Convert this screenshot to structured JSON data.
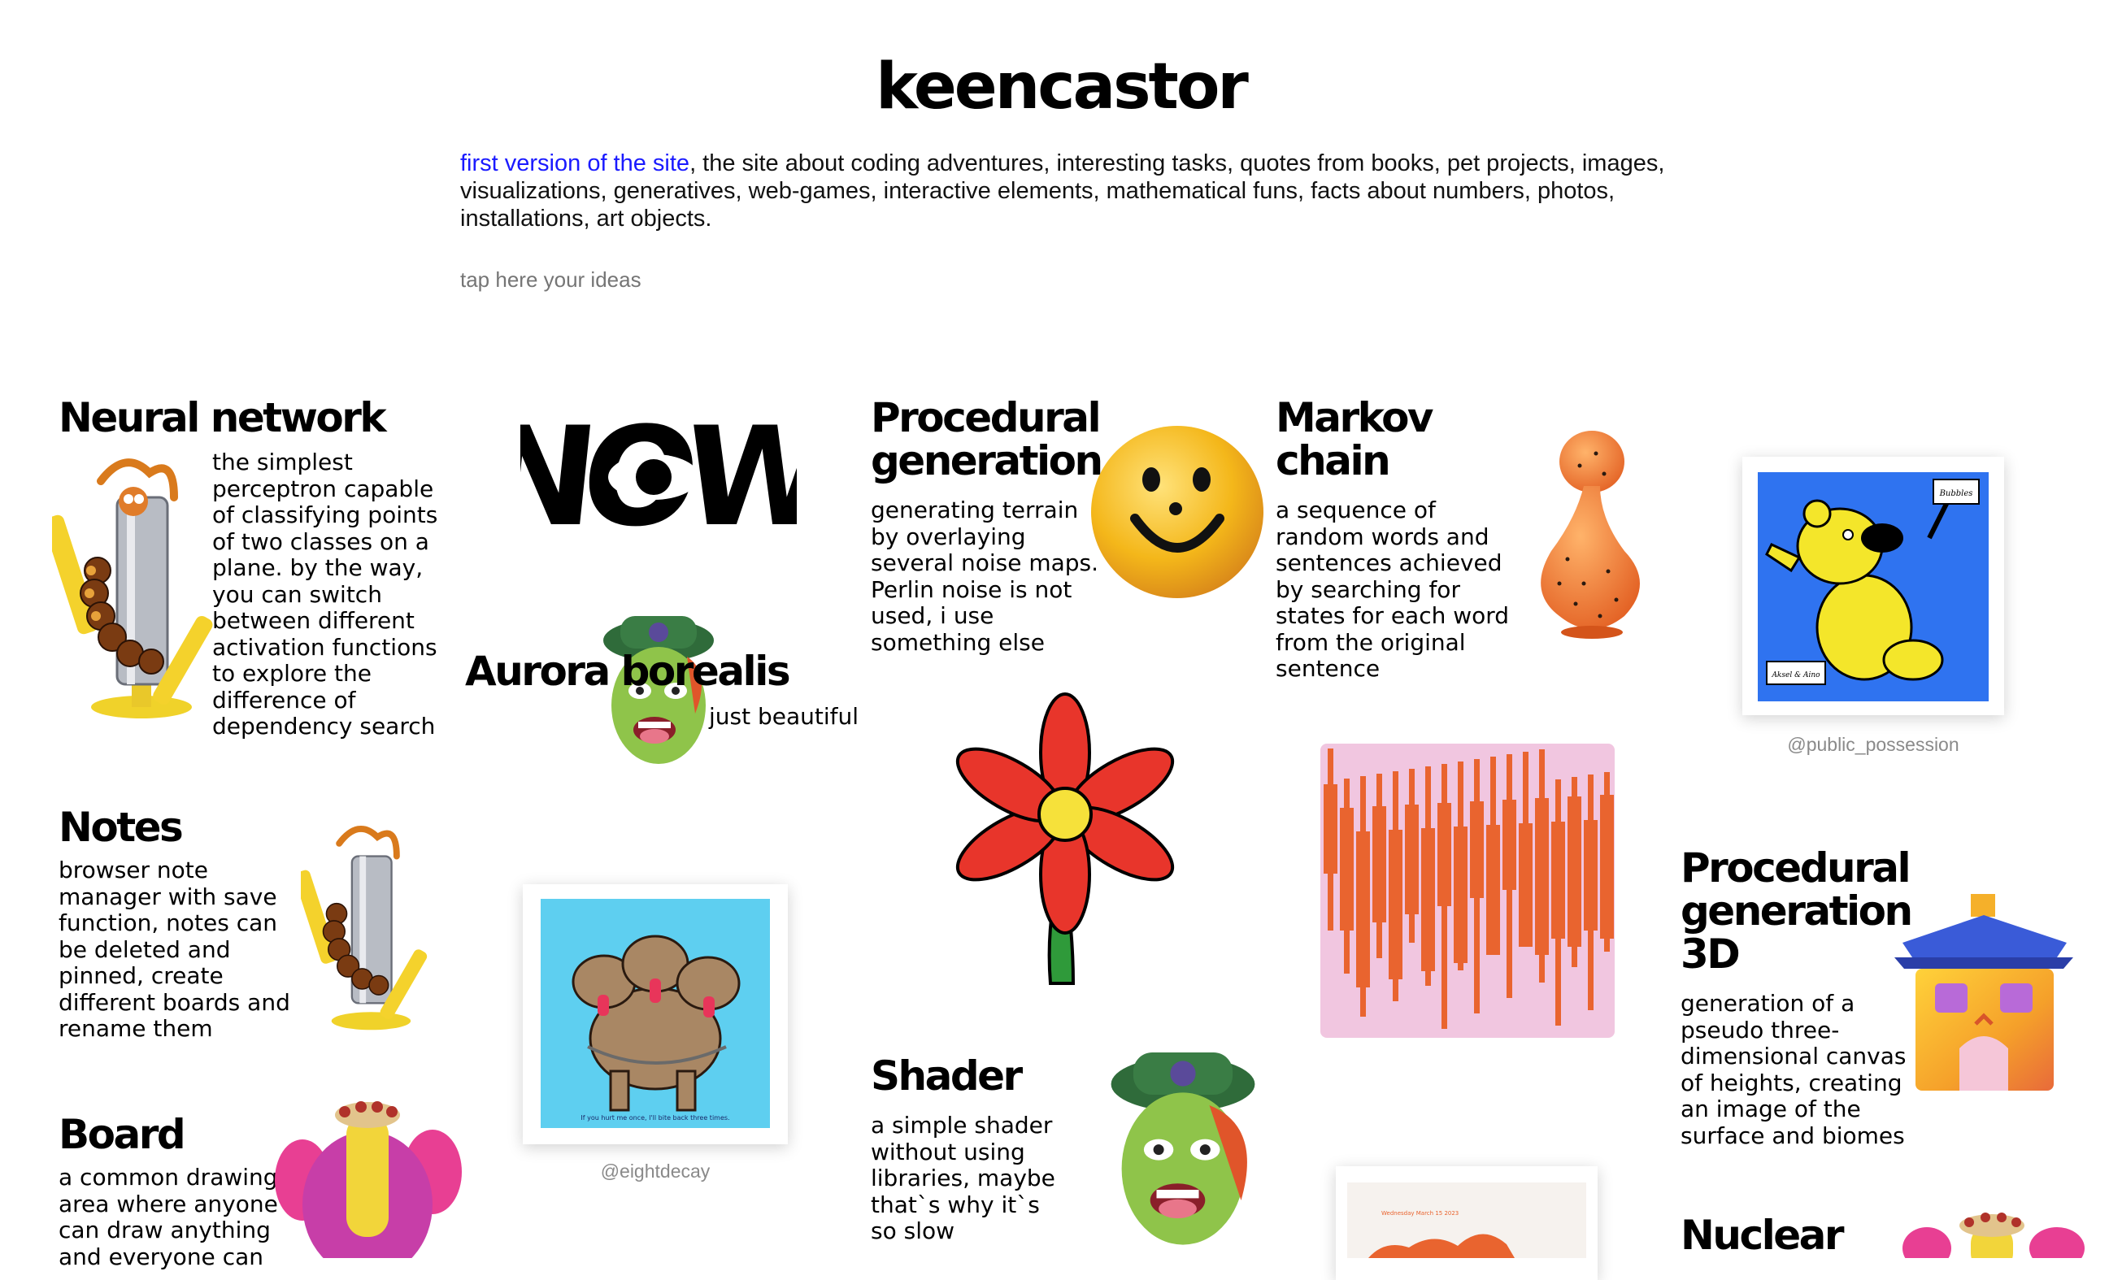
{
  "site": {
    "title": "keencastor",
    "intro_link": "first version of the site",
    "intro_text": ", the site about coding adventures, interesting tasks, quotes from books, pet projects, images, visualizations, generatives, web-games, interactive elements, mathematical funs, facts about numbers, photos, installations, art objects.",
    "ideas_placeholder": "tap here your ideas"
  },
  "cards": {
    "neural": {
      "title": "Neural network",
      "desc": "the simplest perceptron capable of classifying points of two classes on a plane. by the way, you can switch between different activation functions to explore the difference of dependency search"
    },
    "notes": {
      "title": "Notes",
      "desc": "browser note manager with save function, notes can be deleted and pinned, create different boards and rename them"
    },
    "board": {
      "title": "Board",
      "desc": "a common drawing area where anyone can draw anything and everyone can"
    },
    "aurora": {
      "title": "Aurora borealis",
      "desc": "just beautiful"
    },
    "procgen": {
      "title": "Procedural generation",
      "desc": "generating terrain by overlaying several noise maps. Perlin noise is not used, i use something else"
    },
    "shader": {
      "title": "Shader",
      "desc": "a simple shader without using libraries, maybe that`s why it`s so slow"
    },
    "markov": {
      "title": "Markov chain",
      "desc": "a sequence of random words and sentences achieved by searching for states for each word from the original sentence"
    },
    "procgen3d": {
      "title": "Procedural generation 3D",
      "desc": "generation of a pseudo three-dimensional canvas of heights, creating an image of the surface and biomes"
    },
    "nuclear": {
      "title": "Nuclear"
    }
  },
  "art": {
    "now_text": "NOW",
    "dogs_caption": "If you hurt me once, I'll bite back three times.",
    "bear_sign_top": "Bubbles",
    "bear_sign_bottom": "Aksel & Aino",
    "poster_small_text": "Wednesday March 15 2023"
  },
  "credits": {
    "dogs": "@eightdecay",
    "bear": "@public_possession"
  },
  "colors": {
    "link": "#1a1aff",
    "flower_red": "#e8352b",
    "poster_pink": "#f1c6e0",
    "bars_orange": "#e9642f",
    "sky_blue": "#5ecff0",
    "bear_blue": "#2f73f0"
  }
}
